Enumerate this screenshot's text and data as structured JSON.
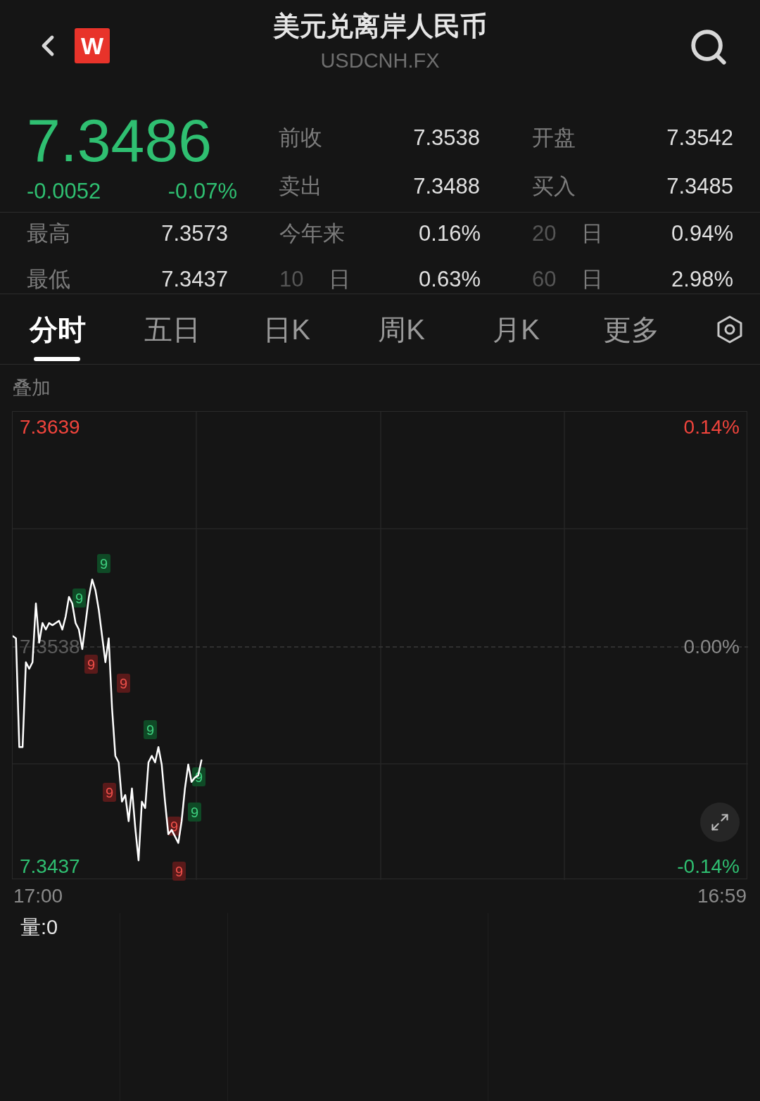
{
  "header": {
    "logo": "W",
    "title": "美元兑离岸人民币",
    "subtitle": "USDCNH.FX"
  },
  "quote": {
    "price": "7.3486",
    "change": "-0.0052",
    "change_percent": "-0.07%",
    "falling": true,
    "fields": [
      {
        "label": "前收",
        "value": "7.3538"
      },
      {
        "label": "开盘",
        "value": "7.3542"
      },
      {
        "label": "卖出",
        "value": "7.3488"
      },
      {
        "label": "买入",
        "value": "7.3485"
      }
    ]
  },
  "stats": [
    {
      "label": "最高",
      "value": "7.3573"
    },
    {
      "label": "今年来",
      "value": "0.16%"
    },
    {
      "count": "20",
      "unit": "日",
      "value": "0.94%"
    },
    {
      "label": "最低",
      "value": "7.3437"
    },
    {
      "count": "10",
      "unit": "日",
      "value": "0.63%"
    },
    {
      "count": "60",
      "unit": "日",
      "value": "2.98%"
    }
  ],
  "tabs": [
    {
      "label": "分时",
      "selected": true
    },
    {
      "label": "五日",
      "selected": false
    },
    {
      "label": "日K",
      "selected": false
    },
    {
      "label": "周K",
      "selected": false
    },
    {
      "label": "月K",
      "selected": false
    },
    {
      "label": "更多",
      "selected": false
    }
  ],
  "overlay_label": "叠加",
  "chart": {
    "chart_data": {
      "type": "line",
      "ylim": [
        7.3431,
        7.3646
      ],
      "ref_lines": [
        {
          "axis": "y",
          "value": 7.3538
        }
      ],
      "categories": [
        null,
        null,
        null,
        null,
        null,
        null,
        null,
        null,
        null,
        null,
        null,
        null,
        null,
        null,
        null,
        null,
        null,
        null,
        null,
        null,
        null,
        null,
        null,
        null,
        null,
        null,
        null,
        null,
        null,
        null,
        null,
        null,
        null,
        null,
        null,
        null,
        null,
        null,
        null,
        null,
        null,
        null,
        null,
        null,
        null,
        null,
        null,
        null,
        null,
        null,
        null,
        null,
        null,
        null,
        null,
        null,
        null,
        null,
        null,
        null,
        null,
        null,
        null,
        null,
        null,
        null,
        null,
        null,
        null,
        null,
        null,
        null,
        null,
        null,
        null,
        null,
        null,
        null,
        null,
        null,
        null,
        null,
        null,
        null,
        null,
        null,
        null,
        null,
        null,
        null,
        null,
        null,
        null,
        null,
        null,
        null,
        null,
        null,
        null,
        null,
        null,
        null,
        null,
        null,
        null,
        null,
        null,
        null,
        null,
        null,
        null,
        null,
        null,
        null,
        null,
        null,
        null,
        null,
        null,
        null,
        null,
        null,
        null,
        null,
        null,
        null,
        null,
        null,
        null,
        null,
        null,
        null,
        null,
        null,
        null,
        null,
        null,
        null,
        null,
        null,
        null,
        null,
        null,
        null,
        null,
        null,
        null,
        null,
        null,
        null,
        null,
        null,
        null,
        null,
        null,
        null,
        null,
        null,
        null,
        null,
        null,
        null,
        null,
        null,
        null,
        null,
        null,
        null,
        null,
        null,
        null,
        null,
        null,
        null,
        null,
        null,
        null,
        null,
        null,
        null,
        null,
        null,
        null,
        null,
        null,
        null,
        null,
        null,
        null,
        null,
        null,
        null,
        null,
        null,
        null,
        null,
        null,
        null,
        null,
        null,
        null,
        null,
        null,
        null,
        null,
        null,
        null,
        null,
        null,
        null,
        null,
        null,
        null,
        null,
        null,
        null,
        null,
        null,
        null,
        null,
        null,
        null,
        null
      ],
      "yticks": [
        {
          "value": 7.3639,
          "label": "7.3639"
        },
        {
          "value": 7.3538,
          "label": "7.3538"
        },
        {
          "value": 7.3437,
          "label": "7.3437"
        }
      ],
      "series": [
        {
          "color": "#ffffff",
          "values": [
            7.3543,
            7.3542,
            7.3492,
            7.3492,
            7.3531,
            7.3528,
            7.3531,
            7.3558,
            7.354,
            7.3549,
            7.3546,
            7.3549,
            7.3548,
            7.3549,
            7.355,
            7.3546,
            7.3552,
            7.3561,
            7.3558,
            7.3549,
            7.3546,
            7.3537,
            7.3549,
            7.3561,
            7.3569,
            7.3564,
            7.3555,
            7.3543,
            7.3531,
            7.3542,
            7.351,
            7.3488,
            7.3485,
            7.3467,
            7.347,
            7.3458,
            7.3473,
            7.3455,
            7.344,
            7.3467,
            7.3464,
            7.3485,
            7.3488,
            7.3485,
            7.3492,
            7.3484,
            7.3467,
            7.3452,
            7.3454,
            7.3451,
            7.3448,
            7.3458,
            7.3473,
            7.3484,
            7.3476,
            7.3478,
            7.3479,
            7.3486,
            null,
            null,
            null,
            null,
            null,
            null,
            null,
            null,
            null,
            null,
            null,
            null,
            null,
            null,
            null,
            null,
            null,
            null,
            null,
            null,
            null,
            null,
            null,
            null,
            null,
            null,
            null,
            null,
            null,
            null,
            null,
            null,
            null,
            null,
            null,
            null,
            null,
            null,
            null,
            null,
            null,
            null,
            null,
            null,
            null,
            null,
            null,
            null,
            null,
            null,
            null,
            null,
            null,
            null,
            null,
            null,
            null,
            null,
            null,
            null,
            null,
            null,
            null,
            null,
            null,
            null,
            null,
            null,
            null,
            null,
            null,
            null,
            null,
            null,
            null,
            null,
            null,
            null,
            null,
            null,
            null,
            null,
            null,
            null,
            null,
            null,
            null,
            null,
            null,
            null,
            null,
            null,
            null,
            null,
            null,
            null,
            null,
            null,
            null,
            null,
            null,
            null,
            null,
            null,
            null,
            null,
            null,
            null,
            null,
            null,
            null,
            null,
            null,
            null,
            null,
            null,
            null,
            null,
            null,
            null,
            null,
            null,
            null,
            null,
            null,
            null,
            null,
            null,
            null,
            null,
            null,
            null,
            null,
            null,
            null,
            null,
            null,
            null,
            null,
            null,
            null,
            null,
            null,
            null,
            null,
            null,
            null,
            null,
            null,
            null,
            null,
            null,
            null,
            null,
            null,
            null,
            null,
            null,
            null,
            null,
            null,
            null,
            null,
            null,
            null
          ]
        }
      ]
    },
    "time_labels": [
      "17:00",
      "16:59"
    ],
    "percent_labels": [
      "0.14%",
      "0.00%",
      "-0.14%"
    ],
    "signals": [
      {
        "label": "9",
        "kind": "top"
      },
      {
        "label": "9",
        "kind": "top"
      },
      {
        "label": "9",
        "kind": "bottom"
      },
      {
        "label": "9",
        "kind": "bottom"
      },
      {
        "label": "9",
        "kind": "top"
      },
      {
        "label": "9",
        "kind": "bottom"
      },
      {
        "label": "9",
        "kind": "bottom"
      },
      {
        "label": "9",
        "kind": "top"
      },
      {
        "label": "9",
        "kind": "top"
      },
      {
        "label": "9",
        "kind": "bottom"
      }
    ]
  },
  "volume_label": "量:0"
}
